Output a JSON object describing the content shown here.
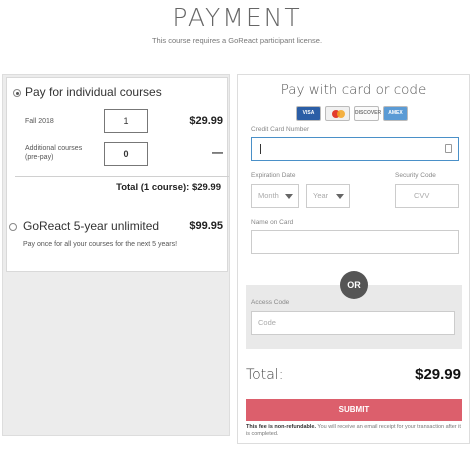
{
  "header": {
    "title": "PAYMENT",
    "subtitle": "This course requires a GoReact participant license."
  },
  "option1": {
    "title": "Pay for individual courses",
    "rows": [
      {
        "label": "Fall 2018",
        "qty": "1",
        "price": "$29.99"
      },
      {
        "label": "Additional courses (pre-pay)",
        "qty": "0",
        "price": "—"
      }
    ],
    "total": "Total (1 course): $29.99"
  },
  "option2": {
    "title": "GoReact 5-year unlimited",
    "price": "$99.95",
    "description": "Pay once for all your courses for the next 5 years!"
  },
  "payment": {
    "title": "Pay with card or code",
    "cards": [
      {
        "name": "VISA",
        "icon": "visa-icon"
      },
      {
        "name": "",
        "icon": "mastercard-icon"
      },
      {
        "name": "DISCOVER",
        "icon": "discover-icon"
      },
      {
        "name": "AMEX",
        "icon": "amex-icon"
      }
    ],
    "cc_label": "Credit Card Number",
    "exp_label": "Expiration Date",
    "month_placeholder": "Month",
    "year_placeholder": "Year",
    "security_label": "Security Code",
    "cvv_placeholder": "CVV",
    "name_label": "Name on Card",
    "or_label": "OR",
    "access_label": "Access Code",
    "code_placeholder": "Code",
    "total_label": "Total:",
    "total_amount": "$29.99",
    "submit_label": "SUBMIT",
    "fee_bold": "This fee is non-refundable.",
    "fee_rest": "You will receive an email receipt for your transaction after it is completed."
  },
  "colors": {
    "submit": "#dc5f6c",
    "focus": "#4a90c8"
  }
}
